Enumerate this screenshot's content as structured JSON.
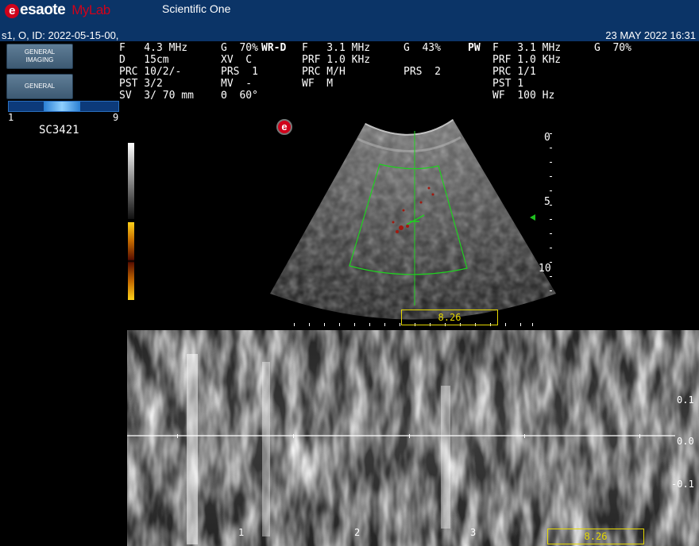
{
  "header": {
    "brand": "esaote",
    "brand_sub_my": "My",
    "brand_sub_lab": "Lab",
    "app_title": "Scientific One",
    "patient_id": "s1, O, ID: 2022-05-15-00,",
    "datetime": "23 MAY 2022 16:31"
  },
  "left_panel": {
    "preset1_line1": "GENERAL",
    "preset1_line2": "IMAGING",
    "preset2": "GENERAL",
    "scale_min": "1",
    "scale_max": "9",
    "probe": "SC3421"
  },
  "params": {
    "bmode_col1": "F   4.3 MHz\nD   15cm\nPRC 10/2/-\nPST 3/2\nSV  3/ 70 mm",
    "bmode_col2": "G  70%\nXV  C\nPRS  1\nMV  -\nΘ  60°",
    "wrd_label": "WR-D",
    "wrd_col1": "F   3.1 MHz\nPRF 1.0 KHz\nPRC M/H\nWF  M",
    "wrd_col2": "G  43%\n\nPRS  2",
    "pw_label": "PW",
    "pw_col1": "F   3.1 MHz\nPRF 1.0 KHz\nPRC 1/1\nPST 1\nWF  100 Hz",
    "pw_col2": "G  70%"
  },
  "image": {
    "logo_mark": "e",
    "depth_labels": [
      "0",
      "5",
      "10"
    ],
    "measure_value_bmode": "8.26"
  },
  "spectrum": {
    "velocity_labels": [
      "0.1",
      "0.0",
      "-0.1"
    ],
    "time_labels": [
      "1",
      "2",
      "3"
    ],
    "measure_value": "8.26"
  }
}
